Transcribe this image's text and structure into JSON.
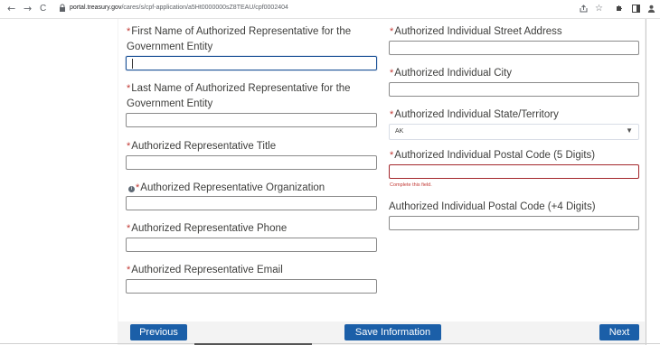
{
  "browser": {
    "back_icon": "←",
    "forward_icon": "→",
    "reload_icon": "C",
    "url_host": "portal.treasury.gov",
    "url_path": "/cares/s/cpf-application/a5Ht0000000sZ8TEAU/cpf0002404",
    "tools": [
      "share-icon",
      "star-icon",
      "extensions-icon",
      "sidebar-icon",
      "profile-icon"
    ]
  },
  "form": {
    "left": {
      "first_name_label": "First Name of Authorized Representative for the Government Entity",
      "first_name_l1": "First Name of Authorized Representative for the",
      "first_name_l2": "Government Entity",
      "last_name_l1": "Last Name of Authorized Representative for the",
      "last_name_l2": "Government Entity",
      "title_label": "Authorized Representative Title",
      "org_label": "Authorized Representative Organization",
      "phone_label": "Authorized Representative Phone",
      "email_label": "Authorized Representative Email"
    },
    "right": {
      "street_label": "Authorized Individual Street Address",
      "city_label": "Authorized Individual City",
      "state_label": "Authorized Individual State/Territory",
      "state_value": "AK",
      "postal_label": "Authorized Individual Postal Code (5 Digits)",
      "postal_error": "Complete this field.",
      "postal4_label": "Authorized Individual Postal Code (+4 Digits)"
    },
    "required_marker": "*",
    "info_icon": "i"
  },
  "buttons": {
    "previous": "Previous",
    "save": "Save Information",
    "next": "Next"
  },
  "colors": {
    "button": "#1b5fa8",
    "required": "#c23934",
    "error_border": "#a3262b",
    "focus_border": "#1b5297"
  }
}
